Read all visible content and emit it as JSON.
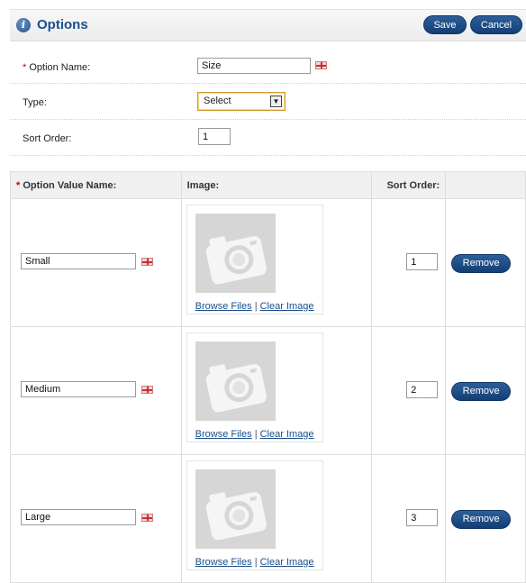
{
  "header": {
    "title": "Options",
    "save_label": "Save",
    "cancel_label": "Cancel"
  },
  "form": {
    "required_mark": "*",
    "option_name_label": "Option Name:",
    "option_name_value": "Size",
    "type_label": "Type:",
    "type_value": "Select",
    "sort_order_label": "Sort Order:",
    "sort_order_value": "1"
  },
  "table": {
    "headers": {
      "option_value_name": "Option Value Name:",
      "image": "Image:",
      "sort_order": "Sort Order:"
    },
    "browse_files_label": "Browse Files",
    "separator": "|",
    "clear_image_label": "Clear Image",
    "remove_label": "Remove",
    "rows": [
      {
        "name": "Small",
        "sort_order": "1"
      },
      {
        "name": "Medium",
        "sort_order": "2"
      },
      {
        "name": "Large",
        "sort_order": "3"
      }
    ]
  },
  "colors": {
    "accent": "#1e4e8c",
    "button": "#143e74",
    "required": "#cc0000"
  }
}
